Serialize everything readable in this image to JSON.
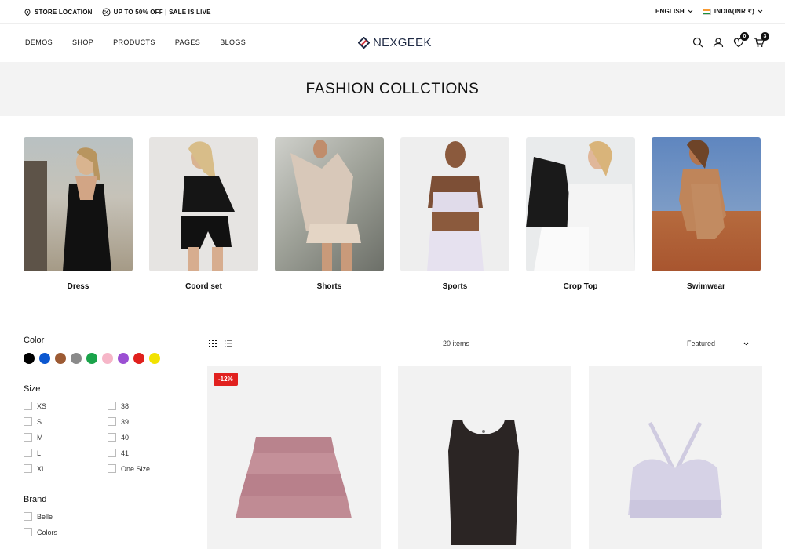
{
  "topbar": {
    "store_location": "STORE LOCATION",
    "sale_text": "UP TO 50% OFF | SALE IS LIVE",
    "language": "ENGLISH",
    "currency": "INDIA(INR ₹)"
  },
  "nav": {
    "items": [
      "DEMOS",
      "SHOP",
      "PRODUCTS",
      "PAGES",
      "BLOGS"
    ]
  },
  "logo": {
    "text": "NEXGEEK",
    "color": "#1f2a44",
    "accent": "#d4373f"
  },
  "header_icons": {
    "wishlist_count": "0",
    "cart_count": "3"
  },
  "page_title": "FASHION COLLCTIONS",
  "categories": [
    {
      "label": "Dress"
    },
    {
      "label": "Coord set"
    },
    {
      "label": "Shorts"
    },
    {
      "label": "Sports"
    },
    {
      "label": "Crop Top"
    },
    {
      "label": "Swimwear"
    }
  ],
  "filters": {
    "color_title": "Color",
    "colors": [
      "#000000",
      "#0b57d0",
      "#9c5a33",
      "#8a8a8a",
      "#1aa34a",
      "#f6b6c8",
      "#9b4fd3",
      "#e0201d",
      "#f2e200"
    ],
    "size_title": "Size",
    "sizes_col1": [
      "XS",
      "S",
      "M",
      "L",
      "XL"
    ],
    "sizes_col2": [
      "38",
      "39",
      "40",
      "41",
      "One Size"
    ],
    "brand_title": "Brand",
    "brands": [
      "Belle",
      "Colors"
    ]
  },
  "toolbar": {
    "item_count": "20 items",
    "sort_selected": "Featured"
  },
  "products": [
    {
      "badge": "-12%"
    },
    {
      "badge": ""
    },
    {
      "badge": ""
    }
  ]
}
